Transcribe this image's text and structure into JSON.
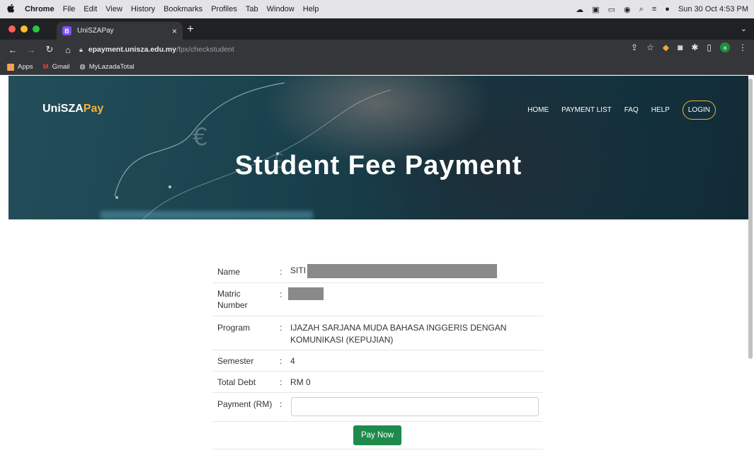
{
  "menubar": {
    "apple": "",
    "app": "Chrome",
    "items": [
      "File",
      "Edit",
      "View",
      "History",
      "Bookmarks",
      "Profiles",
      "Tab",
      "Window",
      "Help"
    ],
    "datetime": "Sun 30 Oct 4:53 PM"
  },
  "browser": {
    "tab_icon_letter": "B",
    "tab_title": "UniSZAPay",
    "tab_close": "×",
    "new_tab": "+",
    "url_host": "epayment.unisza.edu.my",
    "url_path": "/fpx/checkstudent",
    "profile_letter": "a",
    "bookmarks": [
      "Apps",
      "Gmail",
      "MyLazadaTotal"
    ]
  },
  "site": {
    "brand_main": "UniSZA",
    "brand_accent": "Pay",
    "nav": [
      "HOME",
      "PAYMENT LIST",
      "FAQ",
      "HELP"
    ],
    "login": "LOGIN",
    "hero_title": "Student Fee Payment",
    "accent_color": "#f2b33d"
  },
  "form": {
    "separator": ":",
    "name_label": "Name",
    "name_value": "SITI",
    "matric_label_1": "Matric",
    "matric_label_2": "Number",
    "program_label": "Program",
    "program_line1": "IJAZAH SARJANA MUDA BAHASA INGGERIS DENGAN",
    "program_line2": "KOMUNIKASI (KEPUJIAN)",
    "semester_label": "Semester",
    "semester_value": "4",
    "debt_label": "Total Debt",
    "debt_value": "RM 0",
    "payment_label": "Payment (RM)",
    "payment_value": "",
    "pay_button": "Pay Now",
    "button_color": "#1e8a4c"
  }
}
